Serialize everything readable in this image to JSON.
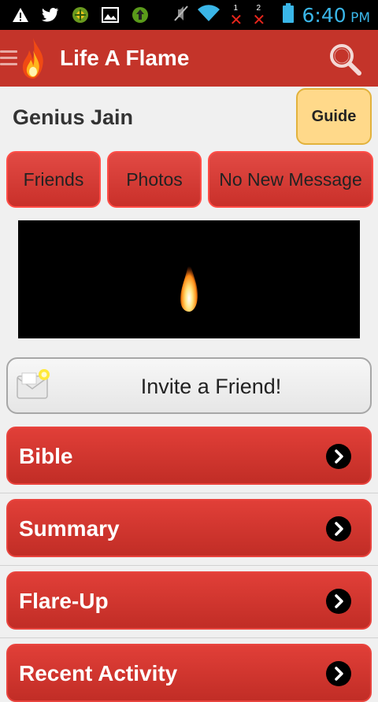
{
  "status_bar": {
    "time": "6:40",
    "period": "PM",
    "sim1_label": "1",
    "sim2_label": "2",
    "icons": [
      "warning-icon",
      "twitter-icon",
      "app-icon",
      "image-icon",
      "upload-icon",
      "mute-icon",
      "wifi-icon",
      "signal-icon",
      "battery-icon"
    ]
  },
  "app_bar": {
    "title": "Life A Flame"
  },
  "profile": {
    "name": "Genius Jain",
    "guide_label": "Guide"
  },
  "tabs": [
    {
      "label": "Friends"
    },
    {
      "label": "Photos"
    },
    {
      "label": "No New Message"
    }
  ],
  "invite": {
    "label": "Invite a Friend!"
  },
  "menu": [
    {
      "label": "Bible"
    },
    {
      "label": "Summary"
    },
    {
      "label": "Flare-Up"
    },
    {
      "label": "Recent Activity"
    }
  ],
  "colors": {
    "primary": "#c4342a",
    "accent_time": "#3ab6e8",
    "guide_bg": "#ffd98a"
  }
}
